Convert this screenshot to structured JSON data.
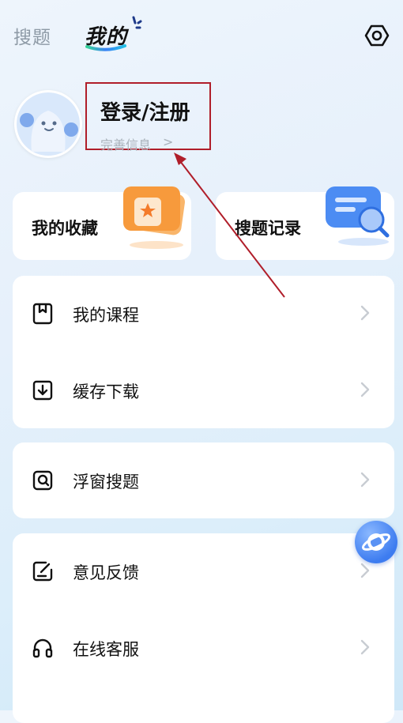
{
  "header": {
    "tab_search": "搜题",
    "tab_mine": "我的",
    "settings_icon": "gear-icon"
  },
  "profile": {
    "login_title": "登录/注册",
    "complete_info": "完善信息",
    "chevron": ">"
  },
  "quick": {
    "favorites_label": "我的收藏",
    "history_label": "搜题记录"
  },
  "menu": {
    "courses": "我的课程",
    "downloads": "缓存下载",
    "float_search": "浮窗搜题",
    "feedback": "意见反馈",
    "service": "在线客服"
  },
  "colors": {
    "accent_blue": "#3d7cf0",
    "annotation_red": "#b01e2a",
    "card_orange": "#f79a3c"
  }
}
